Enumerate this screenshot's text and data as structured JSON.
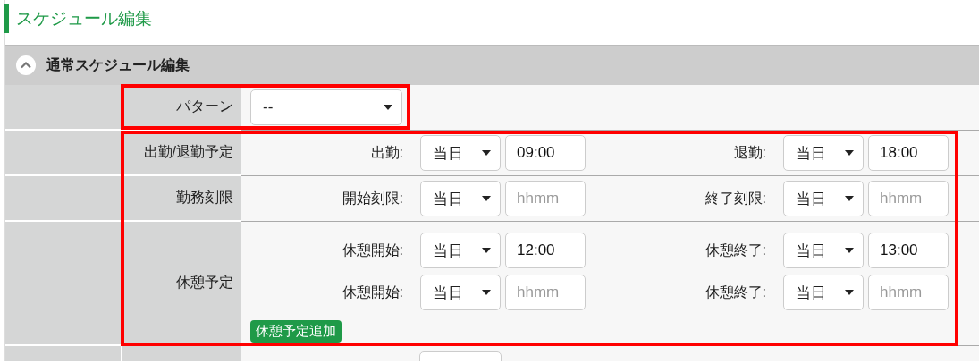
{
  "page_title": "スケジュール編集",
  "section": {
    "title": "通常スケジュール編集",
    "expanded": true,
    "blocks": [
      {
        "highlighted": true,
        "rows": [
          {
            "kind": "pattern",
            "label": "パターン",
            "select": {
              "value": "--"
            }
          }
        ]
      },
      {
        "highlighted": true,
        "rows": [
          {
            "kind": "pairs",
            "label": "出勤/退勤予定",
            "lines": [
              [
                {
                  "label": "出勤:",
                  "day": "当日",
                  "time": {
                    "value": "09:00"
                  }
                },
                {
                  "label": "退勤:",
                  "day": "当日",
                  "time": {
                    "value": "18:00"
                  }
                }
              ]
            ]
          },
          {
            "kind": "pairs",
            "label": "勤務刻限",
            "lines": [
              [
                {
                  "label": "開始刻限:",
                  "day": "当日",
                  "time": {
                    "placeholder": "hhmm"
                  }
                },
                {
                  "label": "終了刻限:",
                  "day": "当日",
                  "time": {
                    "placeholder": "hhmm"
                  }
                }
              ]
            ]
          },
          {
            "kind": "pairs",
            "label": "休憩予定",
            "lines": [
              [
                {
                  "label": "休憩開始:",
                  "day": "当日",
                  "time": {
                    "value": "12:00"
                  }
                },
                {
                  "label": "休憩終了:",
                  "day": "当日",
                  "time": {
                    "value": "13:00"
                  }
                }
              ],
              [
                {
                  "label": "休憩開始:",
                  "day": "当日",
                  "time": {
                    "placeholder": "hhmm"
                  }
                },
                {
                  "label": "休憩終了:",
                  "day": "当日",
                  "time": {
                    "placeholder": "hhmm"
                  }
                }
              ]
            ],
            "button": "休憩予定追加"
          }
        ]
      },
      {
        "highlighted": false,
        "rows": [
          {
            "kind": "cut"
          }
        ]
      }
    ]
  }
}
